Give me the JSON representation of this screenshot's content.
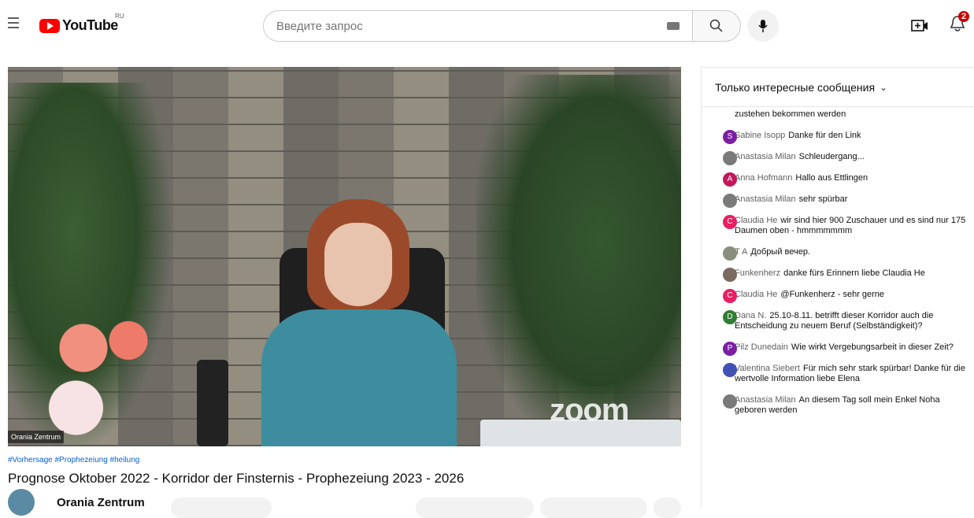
{
  "header": {
    "logo_text": "YouTube",
    "region": "RU",
    "search_placeholder": "Введите запрос",
    "notifications_count": "2"
  },
  "video": {
    "watermark": "zoom",
    "overlay_owner": "Orania Zentrum",
    "hashtags": "#Vorhersage #Prophezeiung #heilung",
    "title": "Prognose Oktober 2022 - Korridor der Finsternis - Prophezeiung 2023 - 2026",
    "channel": "Orania Zentrum"
  },
  "chat": {
    "header": "Только интересные сообщения",
    "messages": [
      {
        "author": "",
        "text": "zustehen bekommen werden",
        "avatar_letter": "",
        "avatar_color": ""
      },
      {
        "author": "Sabine Isopp",
        "text": "Danke für den Link",
        "avatar_letter": "S",
        "avatar_color": "#7b1fa2"
      },
      {
        "author": "Anastasia Milan",
        "text": "Schleudergang...",
        "avatar_letter": "",
        "avatar_color": "#7a7a7a"
      },
      {
        "author": "Anna Hofmann",
        "text": "Hallo aus Ettlingen",
        "avatar_letter": "A",
        "avatar_color": "#c2185b"
      },
      {
        "author": "Anastasia Milan",
        "text": "sehr spürbar",
        "avatar_letter": "",
        "avatar_color": "#7a7a7a"
      },
      {
        "author": "Claudia He",
        "text": "wir sind hier 900 Zuschauer und es sind nur 175 Daumen oben - hmmmmmmm",
        "avatar_letter": "C",
        "avatar_color": "#e91e63"
      },
      {
        "author": "T A",
        "text": "Добрый вечер.",
        "avatar_letter": "",
        "avatar_color": "#8a8f7d"
      },
      {
        "author": "Funkenherz",
        "text": "danke fürs Erinnern liebe Claudia He",
        "avatar_letter": "",
        "avatar_color": "#7a6a60"
      },
      {
        "author": "Claudia He",
        "text": "@Funkenherz - sehr gerne",
        "avatar_letter": "C",
        "avatar_color": "#e91e63"
      },
      {
        "author": "Dana N.",
        "text": "25.10-8.11. betrifft dieser Korridor auch die Entscheidung zu neuem Beruf (Selbständigkeit)?",
        "avatar_letter": "D",
        "avatar_color": "#2e7d32"
      },
      {
        "author": "Pilz Dunedain",
        "text": "Wie wirkt Vergebungsarbeit in dieser Zeit?",
        "avatar_letter": "P",
        "avatar_color": "#7b1fa2"
      },
      {
        "author": "Valentina Siebert",
        "text": "Für mich sehr stark spürbar! Danke für die wertvolle Information liebe Elena",
        "avatar_letter": "",
        "avatar_color": "#3f51b5"
      },
      {
        "author": "Anastasia Milan",
        "text": "An diesem Tag soll mein Enkel Noha geboren werden",
        "avatar_letter": "",
        "avatar_color": "#7a7a7a"
      }
    ]
  }
}
